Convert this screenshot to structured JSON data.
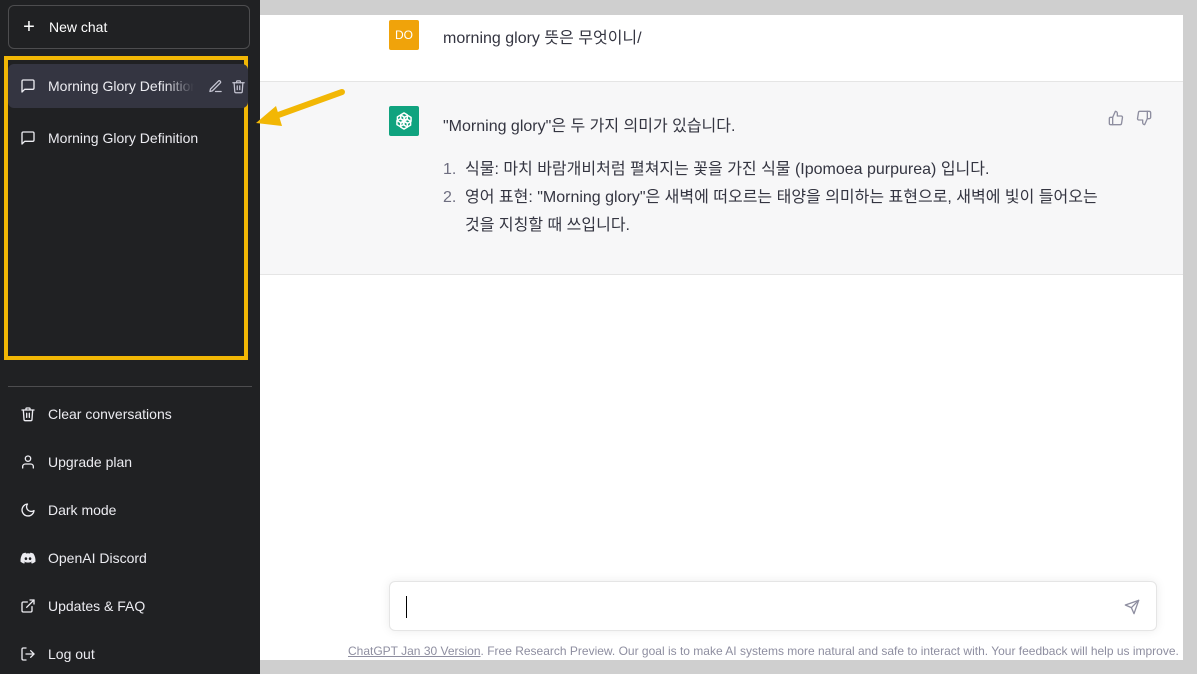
{
  "sidebar": {
    "new_chat_label": "New chat",
    "conversations": [
      {
        "title": "Morning Glory Definition",
        "active": true
      },
      {
        "title": "Morning Glory Definition",
        "active": false
      }
    ],
    "menu": [
      {
        "label": "Clear conversations",
        "icon": "trash-icon"
      },
      {
        "label": "Upgrade plan",
        "icon": "user-icon"
      },
      {
        "label": "Dark mode",
        "icon": "moon-icon"
      },
      {
        "label": "OpenAI Discord",
        "icon": "discord-icon"
      },
      {
        "label": "Updates & FAQ",
        "icon": "external-link-icon"
      },
      {
        "label": "Log out",
        "icon": "logout-icon"
      }
    ]
  },
  "chat": {
    "user_avatar": "DO",
    "user_message": "morning glory 뜻은 무엇이니/",
    "assistant_intro": "\"Morning glory\"은 두 가지 의미가 있습니다.",
    "assistant_items": [
      {
        "num": "1.",
        "text": "식물: 마치 바람개비처럼 펼쳐지는 꽃을 가진 식물 (Ipomoea purpurea) 입니다."
      },
      {
        "num": "2.",
        "text": "영어 표현: \"Morning glory\"은 새벽에 떠오르는 태양을 의미하는 표현으로, 새벽에 빛이 들어오는 것을 지칭할 때 쓰입니다."
      }
    ]
  },
  "composer": {
    "value": "",
    "placeholder": ""
  },
  "footer": {
    "version_link": "ChatGPT Jan 30 Version",
    "text": ". Free Research Preview. Our goal is to make AI systems more natural and safe to interact with. Your feedback will help us improve."
  },
  "colors": {
    "highlight": "#f2b705",
    "gpt_green": "#10a37f",
    "user_avatar": "#f0a30a",
    "sidebar_bg": "#202123"
  }
}
